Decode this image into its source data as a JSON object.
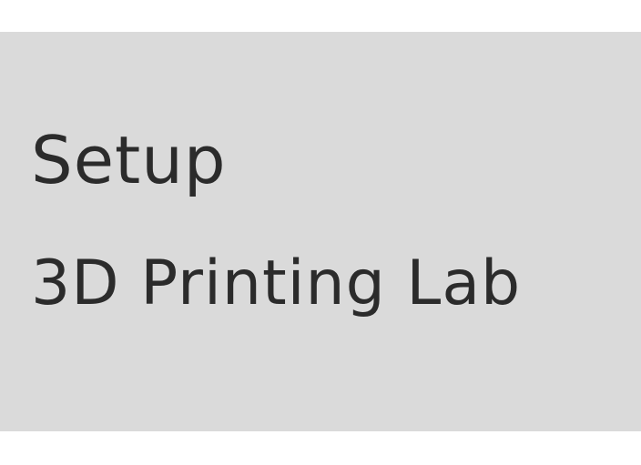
{
  "banner": {
    "line1": "Setup",
    "line2": "3D Printing Lab"
  },
  "colors": {
    "page_background": "#ffffff",
    "panel_background": "#dadada",
    "text": "#2b2b2b"
  }
}
